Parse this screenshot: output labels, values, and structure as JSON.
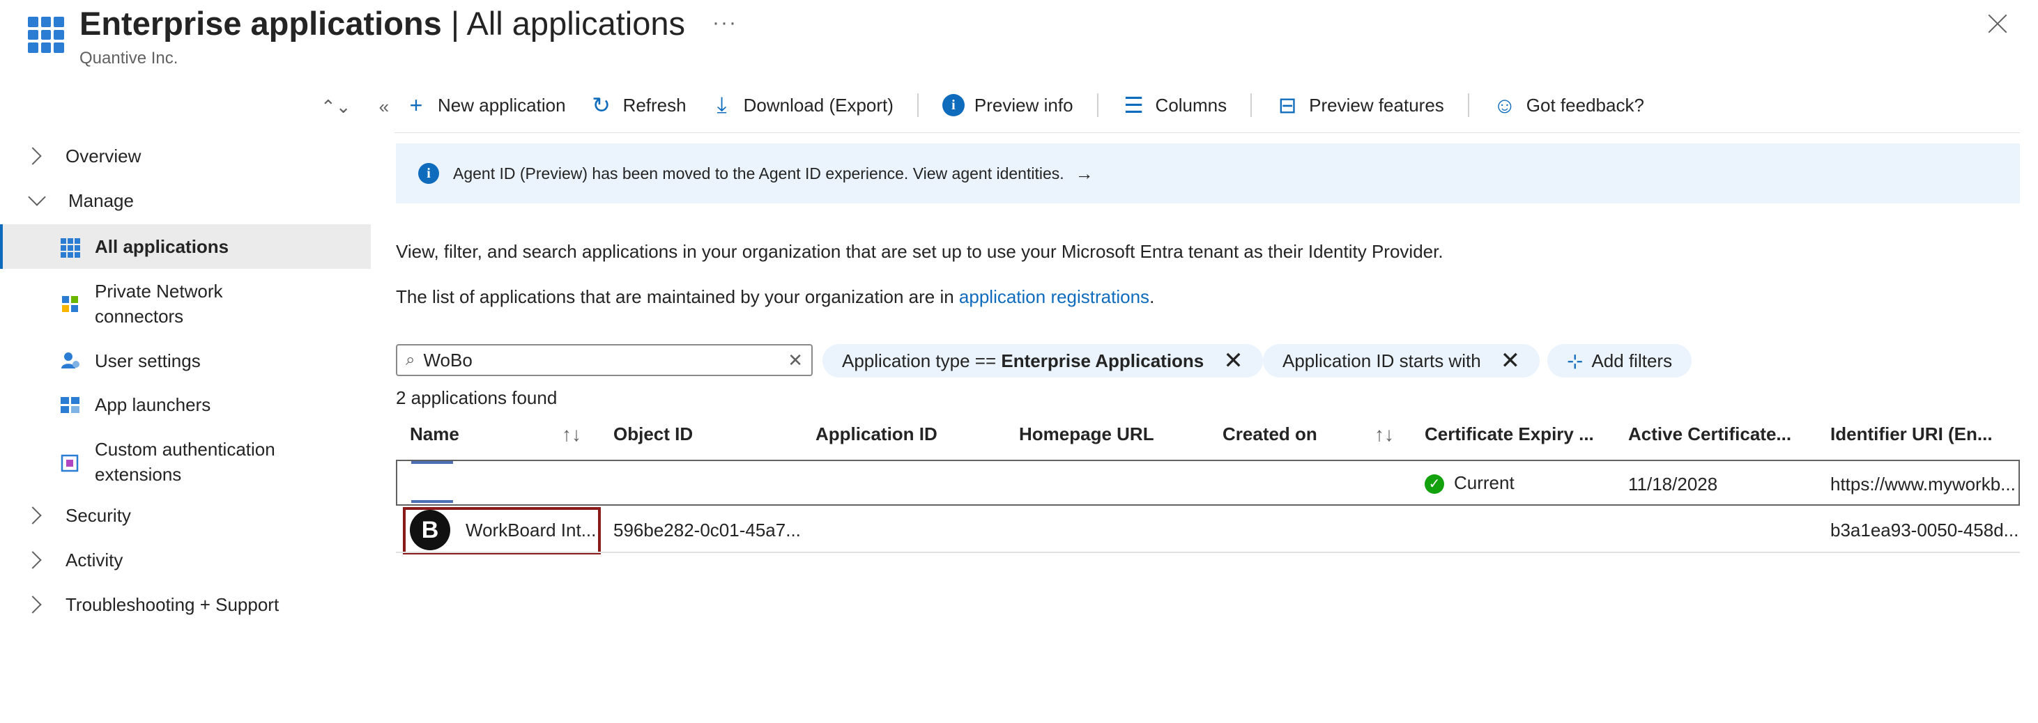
{
  "header": {
    "title_bold": "Enterprise applications",
    "title_rest": " | All applications",
    "subtitle": "Quantive Inc.",
    "more": "···"
  },
  "nav": {
    "overview": "Overview",
    "manage": "Manage",
    "items": [
      {
        "label": "All applications",
        "icon": "grid-icon"
      },
      {
        "label": "Private Network connectors",
        "icon": "network-icon"
      },
      {
        "label": "User settings",
        "icon": "user-settings-icon"
      },
      {
        "label": "App launchers",
        "icon": "app-launcher-icon"
      },
      {
        "label": "Custom authentication extensions",
        "icon": "extension-icon"
      }
    ],
    "security": "Security",
    "activity": "Activity",
    "troubleshooting": "Troubleshooting + Support"
  },
  "toolbar": {
    "new_application": "New application",
    "refresh": "Refresh",
    "download": "Download (Export)",
    "preview_info": "Preview info",
    "columns": "Columns",
    "preview_features": "Preview features",
    "feedback": "Got feedback?"
  },
  "banner": {
    "text": "Agent ID (Preview) has been moved to the Agent ID experience. View agent identities.",
    "arrow": "→"
  },
  "intro": {
    "line1": "View, filter, and search applications in your organization that are set up to use your Microsoft Entra tenant as their Identity Provider.",
    "line2_prefix": "The list of applications that are maintained by your organization are in ",
    "line2_link": "application registrations",
    "line2_suffix": "."
  },
  "search": {
    "value": "WoBo"
  },
  "filters": {
    "app_type_prefix": "Application type == ",
    "app_type_value": "Enterprise Applications",
    "app_id": "Application ID starts with",
    "add": "Add filters"
  },
  "results_count": "2 applications found",
  "table": {
    "columns": [
      "Name",
      "Object ID",
      "Application ID",
      "Homepage URL",
      "Created on",
      "Certificate Expiry ...",
      "Active Certificate...",
      "Identifier URI (En..."
    ],
    "rows": [
      {
        "name": "",
        "object_id": "",
        "app_id": "",
        "homepage": "",
        "created": "",
        "cert_status": "Current",
        "active_cert": "11/18/2028",
        "identifier": "https://www.myworkb..."
      },
      {
        "name": "WorkBoard Int...",
        "object_id": "596be282-0c01-45a7...",
        "app_id": "",
        "homepage": "",
        "created": "",
        "cert_status": "",
        "active_cert": "",
        "identifier": "b3a1ea93-0050-458d..."
      }
    ]
  }
}
